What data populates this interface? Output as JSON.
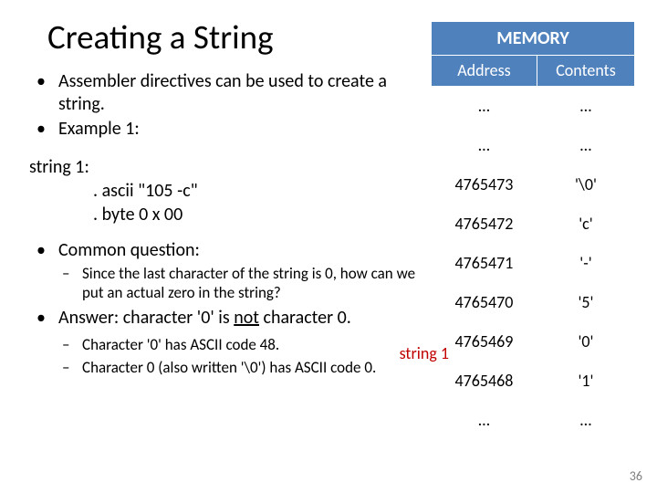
{
  "title": "Creating a String",
  "bullets": {
    "b1": "Assembler directives can be used to create a string.",
    "b2": "Example 1:",
    "b3": "Common question:",
    "b4_pre": "Answer: character '0' is ",
    "b4_not": "not",
    "b4_post": " character 0."
  },
  "code": {
    "l1": "string 1:",
    "l2": ". ascii \"105 -c\"",
    "l3": ". byte 0 x 00"
  },
  "sub": {
    "q1": "Since the last character of the string is 0, how can we put an actual zero in the string?",
    "a1": "Character '0' has ASCII code 48.",
    "a2": "Character 0 (also written '\\0') has ASCII code 0."
  },
  "memory": {
    "title": "MEMORY",
    "headers": {
      "addr": "Address",
      "cont": "Contents"
    },
    "rows": [
      {
        "a": "…",
        "c": "…"
      },
      {
        "a": "…",
        "c": "…"
      },
      {
        "a": "4765473",
        "c": "'\\0'"
      },
      {
        "a": "4765472",
        "c": "'c'"
      },
      {
        "a": "4765471",
        "c": "'-'"
      },
      {
        "a": "4765470",
        "c": "'5'"
      },
      {
        "a": "4765469",
        "c": "'0'"
      },
      {
        "a": "4765468",
        "c": "'1'"
      },
      {
        "a": "…",
        "c": "…"
      }
    ]
  },
  "string1_label": "string 1",
  "page_num": "36"
}
